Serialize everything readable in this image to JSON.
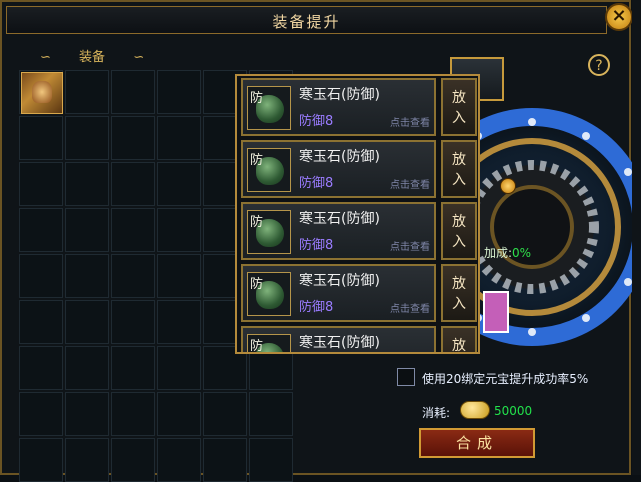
{
  "window": {
    "title": "装备提升"
  },
  "inventory": {
    "section_label": "装备",
    "columns": 6,
    "rows": 9
  },
  "popup": {
    "items": [
      {
        "tag": "防",
        "name": "寒玉石(防御)",
        "stat": "防御8",
        "view": "点击查看",
        "action": "放入"
      },
      {
        "tag": "防",
        "name": "寒玉石(防御)",
        "stat": "防御8",
        "view": "点击查看",
        "action": "放入"
      },
      {
        "tag": "防",
        "name": "寒玉石(防御)",
        "stat": "防御8",
        "view": "点击查看",
        "action": "放入"
      },
      {
        "tag": "防",
        "name": "寒玉石(防御)",
        "stat": "防御8",
        "view": "点击查看",
        "action": "放入"
      },
      {
        "tag": "防",
        "name": "寒玉石(防御)",
        "stat": "",
        "view": "",
        "action": "放"
      }
    ]
  },
  "upgrade": {
    "rate_label": "加成:",
    "rate_value": "0%",
    "checkbox_label": "使用20绑定元宝提升成功率5%",
    "consume_label": "消耗:",
    "consume_amount": "50000",
    "craft_button": "合成"
  },
  "colors": {
    "accent_gold": "#b48a3b",
    "success_green": "#2ee04a",
    "stat_purple": "#9a7cff"
  }
}
